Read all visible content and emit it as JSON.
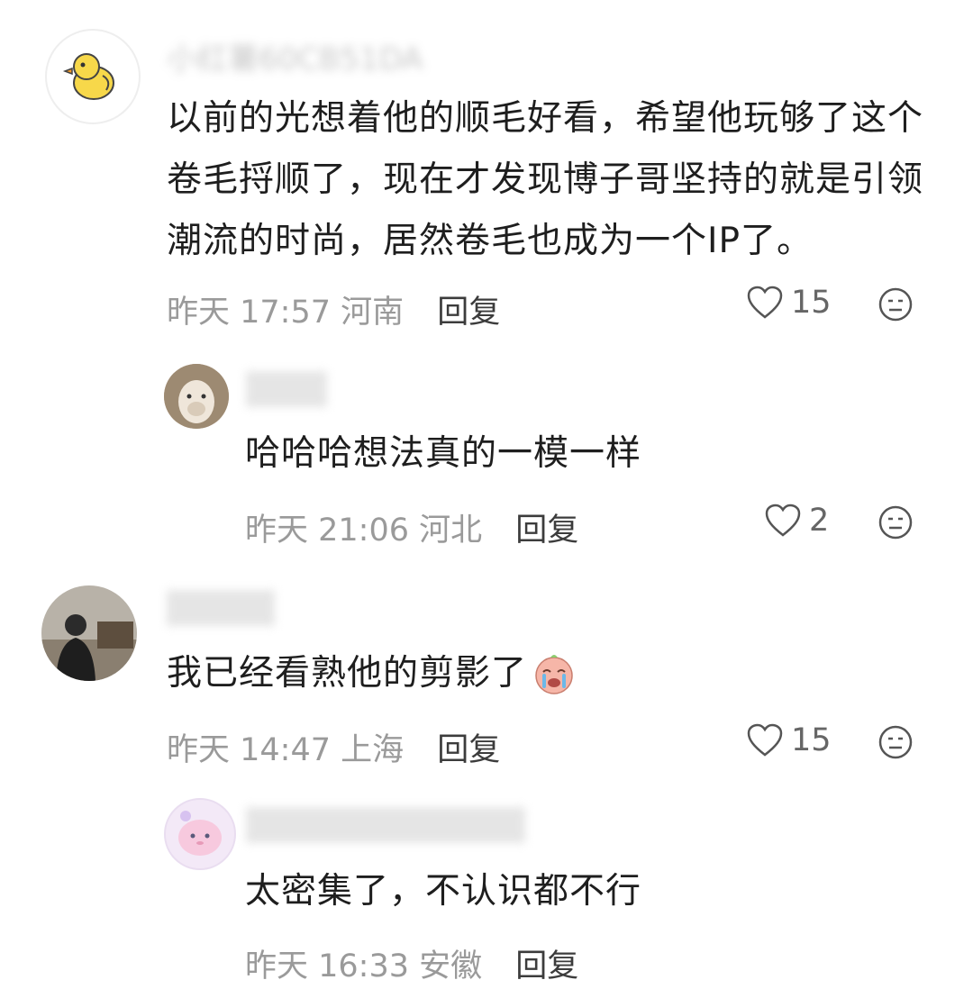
{
  "comments": [
    {
      "username": "小红薯60CB51DA",
      "text": "以前的光想着他的顺毛好看，希望他玩够了这个卷毛捋顺了，现在才发现博子哥坚持的就是引领潮流的时尚，居然卷毛也成为一个IP了。",
      "time": "昨天 17:57",
      "location": "河南",
      "reply_label": "回复",
      "likes": "15"
    },
    {
      "username": "",
      "text": "哈哈哈想法真的一模一样",
      "time": "昨天 21:06",
      "location": "河北",
      "reply_label": "回复",
      "likes": "2"
    },
    {
      "username": "",
      "text": "我已经看熟他的剪影了",
      "time": "昨天 14:47",
      "location": "上海",
      "reply_label": "回复",
      "likes": "15"
    },
    {
      "username": "",
      "text": "太密集了，不认识都不行",
      "time": "昨天 16:33",
      "location": "安徽",
      "reply_label": "回复",
      "likes": ""
    }
  ]
}
